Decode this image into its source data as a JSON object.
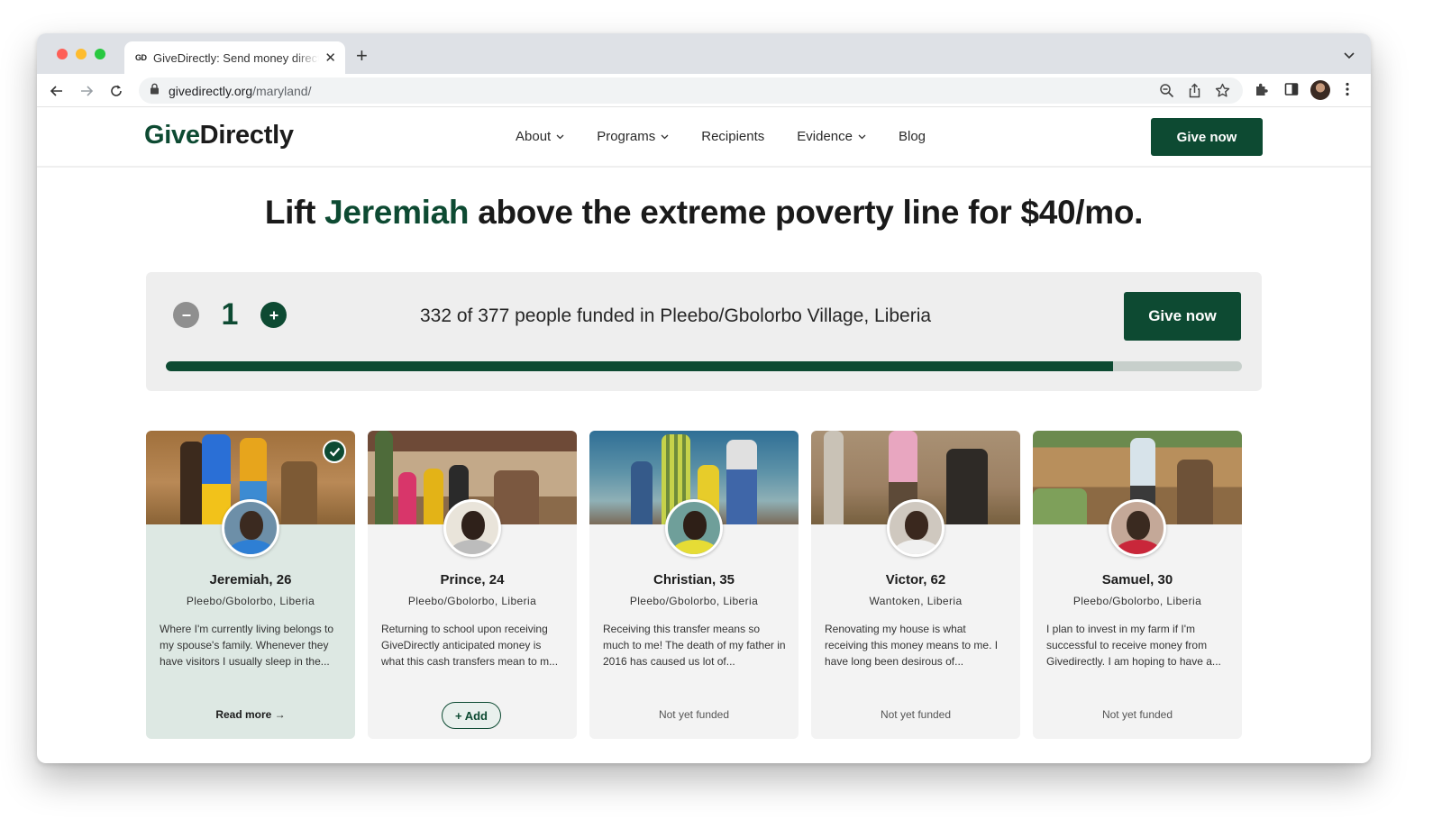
{
  "browser": {
    "tab_title": "GiveDirectly: Send money directly to the extreme poor",
    "tab_favicon": "GD",
    "url_domain": "givedirectly.org",
    "url_path": "/maryland/"
  },
  "site": {
    "logo_give": "Give",
    "logo_directly": "Directly",
    "nav": [
      {
        "label": "About",
        "has_dropdown": true
      },
      {
        "label": "Programs",
        "has_dropdown": true
      },
      {
        "label": "Recipients",
        "has_dropdown": false
      },
      {
        "label": "Evidence",
        "has_dropdown": true
      },
      {
        "label": "Blog",
        "has_dropdown": false
      }
    ],
    "header_cta": "Give now"
  },
  "headline": {
    "prefix": "Lift ",
    "name": "Jeremiah",
    "suffix": " above the extreme poverty line for $40/mo."
  },
  "progress": {
    "quantity": "1",
    "funded_text": "332 of 377 people funded in Pleebo/Gbolorbo Village, Liberia",
    "funded": 332,
    "total": 377,
    "cta": "Give now"
  },
  "recipients": [
    {
      "name": "Jeremiah, 26",
      "location": "Pleebo/Gbolorbo, Liberia",
      "story": "Where I'm currently living belongs to my spouse's family. Whenever they have visitors I usually sleep in the...",
      "action": "Read more →",
      "state": "selected"
    },
    {
      "name": "Prince, 24",
      "location": "Pleebo/Gbolorbo, Liberia",
      "story": "Returning to school upon receiving GiveDirectly anticipated money is what this cash transfers mean to m...",
      "action": "+ Add",
      "state": "addable"
    },
    {
      "name": "Christian, 35",
      "location": "Pleebo/Gbolorbo, Liberia",
      "story": "Receiving this transfer means so much to me! The death of my father in 2016 has caused us lot of...",
      "action": "Not yet funded",
      "state": "not-funded"
    },
    {
      "name": "Victor, 62",
      "location": "Wantoken, Liberia",
      "story": "Renovating my house is what receiving this money means to me. I have long been desirous of...",
      "action": "Not yet funded",
      "state": "not-funded"
    },
    {
      "name": "Samuel, 30",
      "location": "Pleebo/Gbolorbo, Liberia",
      "story": "I plan to invest in my farm if I'm successful to receive money from Givedirectly. I am hoping to have a...",
      "action": "Not yet funded",
      "state": "not-funded"
    }
  ],
  "colors": {
    "brand_green": "#0d4a32",
    "selected_card": "#dde8e3",
    "card_bg": "#f3f3f3"
  }
}
